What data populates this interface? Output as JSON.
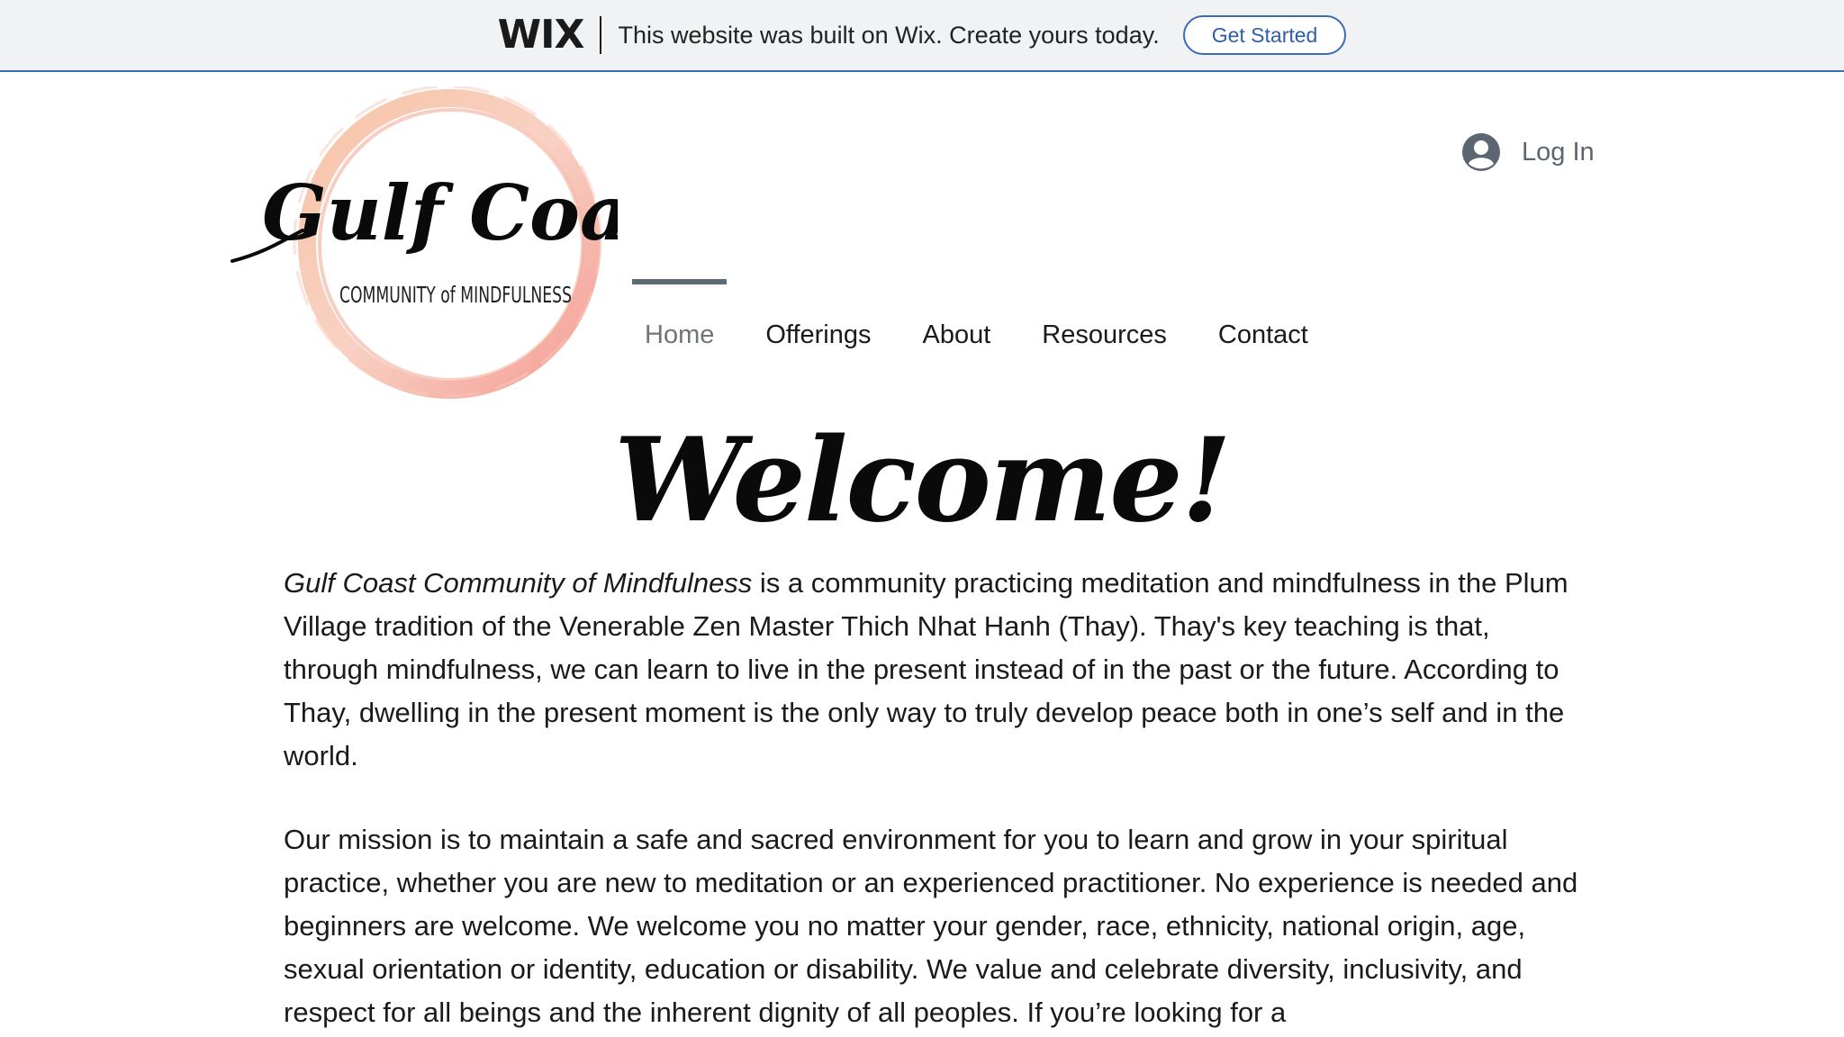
{
  "banner": {
    "logo": "WIX",
    "text": "This website was built on Wix. Create yours today.",
    "cta_label": "Get Started",
    "accent": "#3b6bb3"
  },
  "header": {
    "logo": {
      "script_text": "Gulf Coast",
      "subtitle_text": "COMMUNITY of MINDFULNESS",
      "ring_color": "#f29e85"
    },
    "login": {
      "icon": "user-avatar-icon",
      "label": "Log In"
    },
    "nav": {
      "items": [
        {
          "label": "Home",
          "active": true
        },
        {
          "label": "Offerings"
        },
        {
          "label": "About"
        },
        {
          "label": "Resources"
        },
        {
          "label": "Contact"
        }
      ]
    }
  },
  "main": {
    "heading": "Welcome!",
    "paragraph1": {
      "lead_italic": "Gulf Coast Community of Mindfulness",
      "rest": " is a community practicing meditation and mindfulness in the Plum Village tradition of the Venerable Zen Master Thich Nhat Hanh (Thay). Thay's key teaching is that, through mindfulness, we can learn to live in the present instead of in the past or the future. According to Thay, dwelling in the present moment is the only way to truly develop peace both in one’s self and in the world."
    },
    "paragraph2": "Our mission is to maintain a safe and sacred environment for you to learn and grow in your spiritual practice, whether you are new to meditation or an experienced practitioner. No experience is needed and beginners are welcome.  We welcome you no matter your gender, race, ethnicity, national origin, age, sexual orientation or identity, education or disability.  We value and celebrate diversity, inclusivity, and respect for all beings and the inherent dignity of all peoples. If you’re looking for a"
  }
}
